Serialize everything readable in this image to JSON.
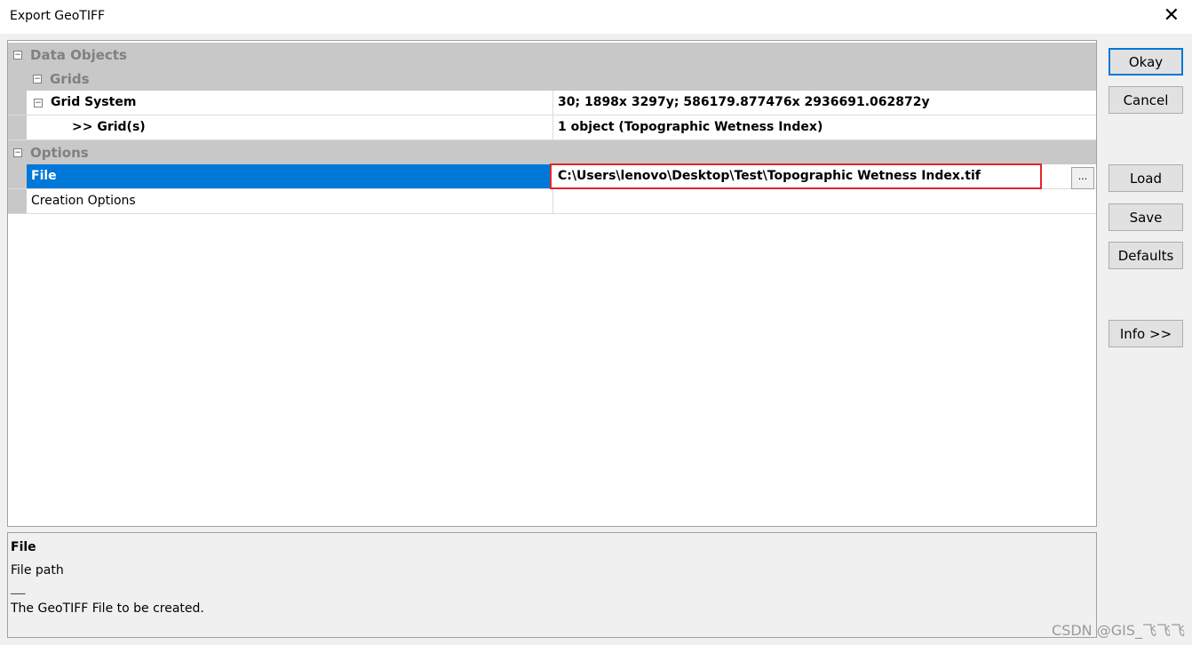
{
  "window": {
    "title": "Export GeoTIFF",
    "close_glyph": "✕"
  },
  "grid": {
    "categories": {
      "data_objects": "Data Objects",
      "grids": "Grids",
      "options": "Options"
    },
    "grid_system": {
      "name": "Grid System",
      "value": "30; 1898x 3297y; 586179.877476x 2936691.062872y"
    },
    "grids_item": {
      "name": ">> Grid(s)",
      "value": "1 object (Topographic Wetness Index)"
    },
    "file": {
      "name": "File",
      "value": "C:\\Users\\lenovo\\Desktop\\Test\\Topographic Wetness Index.tif",
      "browse_label": "..."
    },
    "creation_options": {
      "name": "Creation Options",
      "value": ""
    },
    "expander_glyph": "−"
  },
  "description": {
    "heading": "File",
    "subtitle": "File path",
    "separator": "___",
    "text": "The GeoTIFF File to be created."
  },
  "buttons": {
    "okay": "Okay",
    "cancel": "Cancel",
    "load": "Load",
    "save": "Save",
    "defaults": "Defaults",
    "info": "Info >>"
  },
  "watermark": "CSDN @GIS_飞飞飞"
}
